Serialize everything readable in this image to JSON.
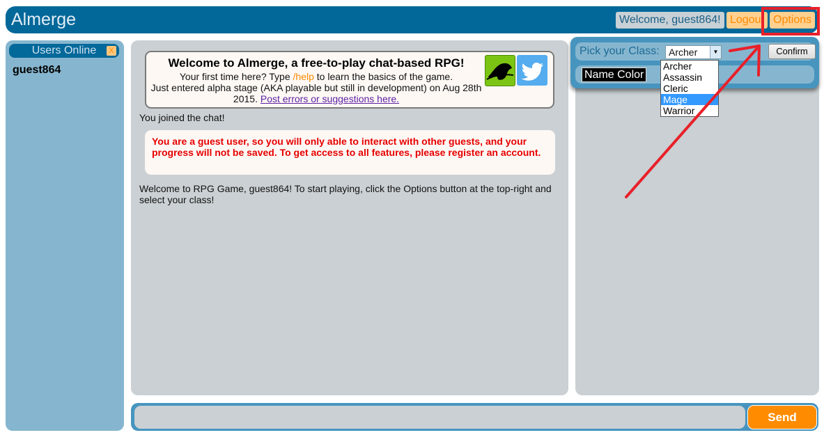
{
  "header": {
    "title": "Almerge",
    "welcome": "Welcome, guest864!",
    "logout_label": "Logout",
    "options_label": "Options"
  },
  "users_panel": {
    "title": "Users Online",
    "close_label": "X",
    "users": [
      "guest864"
    ]
  },
  "welcome_box": {
    "title": "Welcome to Almerge, a free-to-play chat-based RPG!",
    "line1_pre": "Your first time here? Type ",
    "help_command": "/help",
    "line1_post": " to learn the basics of the game.",
    "line2": "Just entered alpha stage (AKA playable but still in development) on Aug 28th 2015. ",
    "link_text": "Post errors or suggestions here.",
    "icons": [
      "kongregate-icon",
      "twitter-icon"
    ]
  },
  "chat": {
    "messages": [
      "You joined the chat!",
      "You are a guest user, so you will only able to interact with other guests, and your progress will not be saved. To get access to all features, please register an account.",
      "Welcome to RPG Game, guest864! To start playing, click the Options button at the top-right and select your class!"
    ],
    "input_value": "",
    "send_label": "Send"
  },
  "options": {
    "class_label": "Pick your Class:",
    "selected_class": "Archer",
    "class_options": [
      "Archer",
      "Assassin",
      "Cleric",
      "Mage",
      "Warrior"
    ],
    "highlighted_option": "Mage",
    "confirm_label": "Confirm",
    "name_color_label": "Name Color"
  },
  "colors": {
    "header_bg": "#02689a",
    "accent_orange": "#ff8c00",
    "warning_red": "#e60000",
    "panel_blue": "#4795bf",
    "annotation_red": "#e8202a"
  }
}
